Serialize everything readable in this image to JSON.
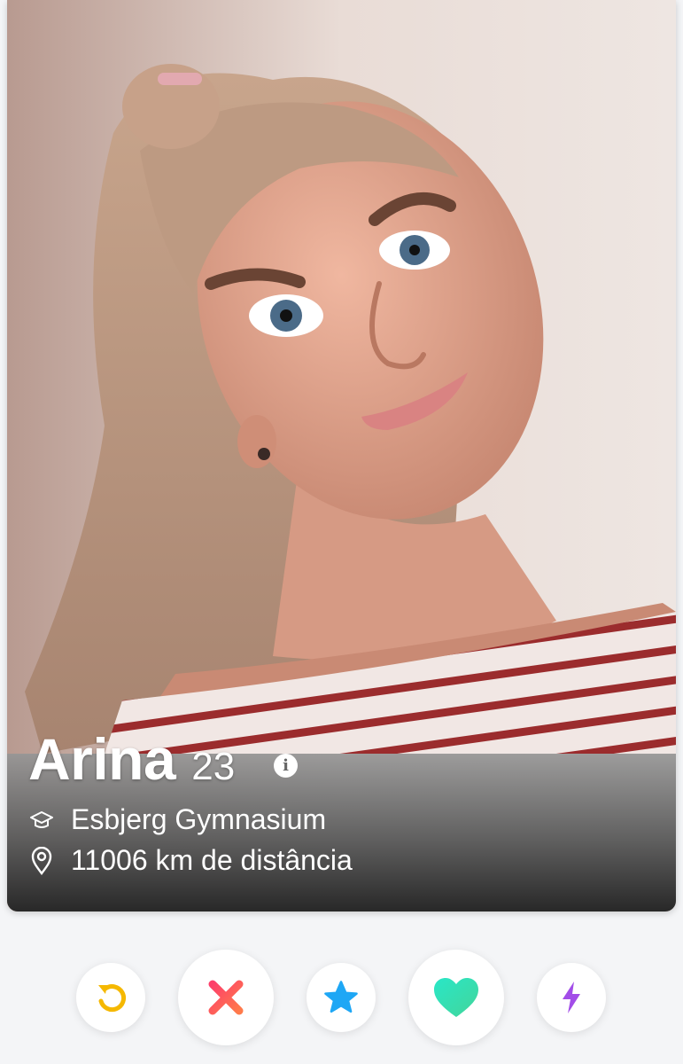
{
  "profile": {
    "name": "Arina",
    "age": "23",
    "school": "Esbjerg Gymnasium",
    "distance": "11006 km de distância",
    "photo_description": ""
  },
  "icons": {
    "info": "i",
    "school": "graduation-cap-icon",
    "location": "location-pin-icon"
  },
  "actions": {
    "rewind": {
      "icon": "rewind-icon",
      "color": "#f5b800"
    },
    "nope": {
      "icon": "close-icon",
      "color": "#fd4d5d"
    },
    "super_like": {
      "icon": "star-icon",
      "color": "#1ea7f5"
    },
    "like": {
      "icon": "heart-icon",
      "color": "#3ee0b0"
    },
    "boost": {
      "icon": "bolt-icon",
      "color": "#a24de8"
    }
  },
  "colors": {
    "background": "#f4f5f7"
  }
}
